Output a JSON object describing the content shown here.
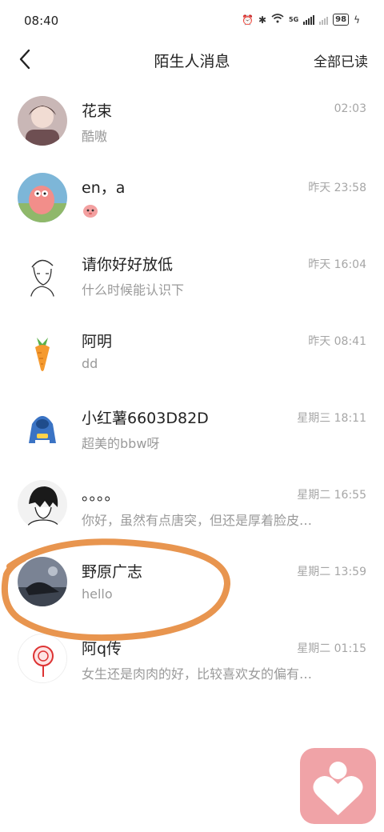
{
  "status_bar": {
    "time": "08:40",
    "network": "5G",
    "battery": "98"
  },
  "header": {
    "title": "陌生人消息",
    "mark_all_read": "全部已读"
  },
  "messages": [
    {
      "name": "花束",
      "preview": "酷嗷",
      "time": "02:03"
    },
    {
      "name": "en，a",
      "preview": "",
      "time": "昨天 23:58"
    },
    {
      "name": "请你好好放低",
      "preview": "什么时候能认识下",
      "time": "昨天 16:04"
    },
    {
      "name": "阿明",
      "preview": "dd",
      "time": "昨天 08:41"
    },
    {
      "name": "小红薯6603D82D",
      "preview": "超美的bbw呀",
      "time": "星期三 18:11"
    },
    {
      "name": "。。。。",
      "preview": "你好，虽然有点唐突，但还是厚着脸皮…",
      "time": "星期二 16:55"
    },
    {
      "name": "野原广志",
      "preview": "hello",
      "time": "星期二 13:59"
    },
    {
      "name": "阿q传",
      "preview": "女生还是肉肉的好，比较喜欢女的偏有…",
      "time": "星期二 01:15"
    }
  ],
  "colors": {
    "annotation": "#e8954f",
    "fab_background": "#f0a3a7",
    "secondary_text": "#9a9a9a"
  }
}
